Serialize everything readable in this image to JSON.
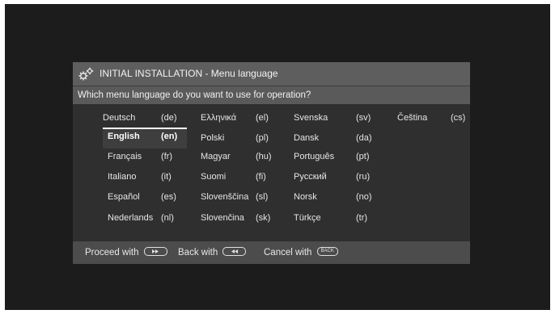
{
  "dialog": {
    "title": "INITIAL INSTALLATION - Menu language",
    "question": "Which menu language do you want to use for operation?"
  },
  "languages": [
    {
      "name": "Deutsch",
      "code": "(de)"
    },
    {
      "name": "English",
      "code": "(en)",
      "selected": true
    },
    {
      "name": "Français",
      "code": "(fr)"
    },
    {
      "name": "Italiano",
      "code": "(it)"
    },
    {
      "name": "Español",
      "code": "(es)"
    },
    {
      "name": "Nederlands",
      "code": "(nl)"
    },
    {
      "name": "Ελληνικά",
      "code": "(el)"
    },
    {
      "name": "Polski",
      "code": "(pl)"
    },
    {
      "name": "Magyar",
      "code": "(hu)"
    },
    {
      "name": "Suomi",
      "code": "(fi)"
    },
    {
      "name": "Slovenščina",
      "code": "(sl)"
    },
    {
      "name": "Slovenčina",
      "code": "(sk)"
    },
    {
      "name": "Svenska",
      "code": "(sv)"
    },
    {
      "name": "Dansk",
      "code": "(da)"
    },
    {
      "name": "Português",
      "code": "(pt)"
    },
    {
      "name": "Русский",
      "code": "(ru)"
    },
    {
      "name": "Norsk",
      "code": "(no)"
    },
    {
      "name": "Türkçe",
      "code": "(tr)"
    },
    {
      "name": "Čeština",
      "code": "(cs)"
    }
  ],
  "footer": {
    "proceed_label": "Proceed with",
    "back_label": "Back with",
    "cancel_label": "Cancel with",
    "back_button_text": "BACK"
  },
  "colors": {
    "screen_background": "#1c1c1c",
    "title_bar": "#5e5e5e",
    "selection_highlight": "#ffffff"
  },
  "icons": {
    "title": "gears-icon",
    "proceed": "fast-forward-icon",
    "back": "rewind-icon",
    "cancel": "back-button-icon"
  }
}
